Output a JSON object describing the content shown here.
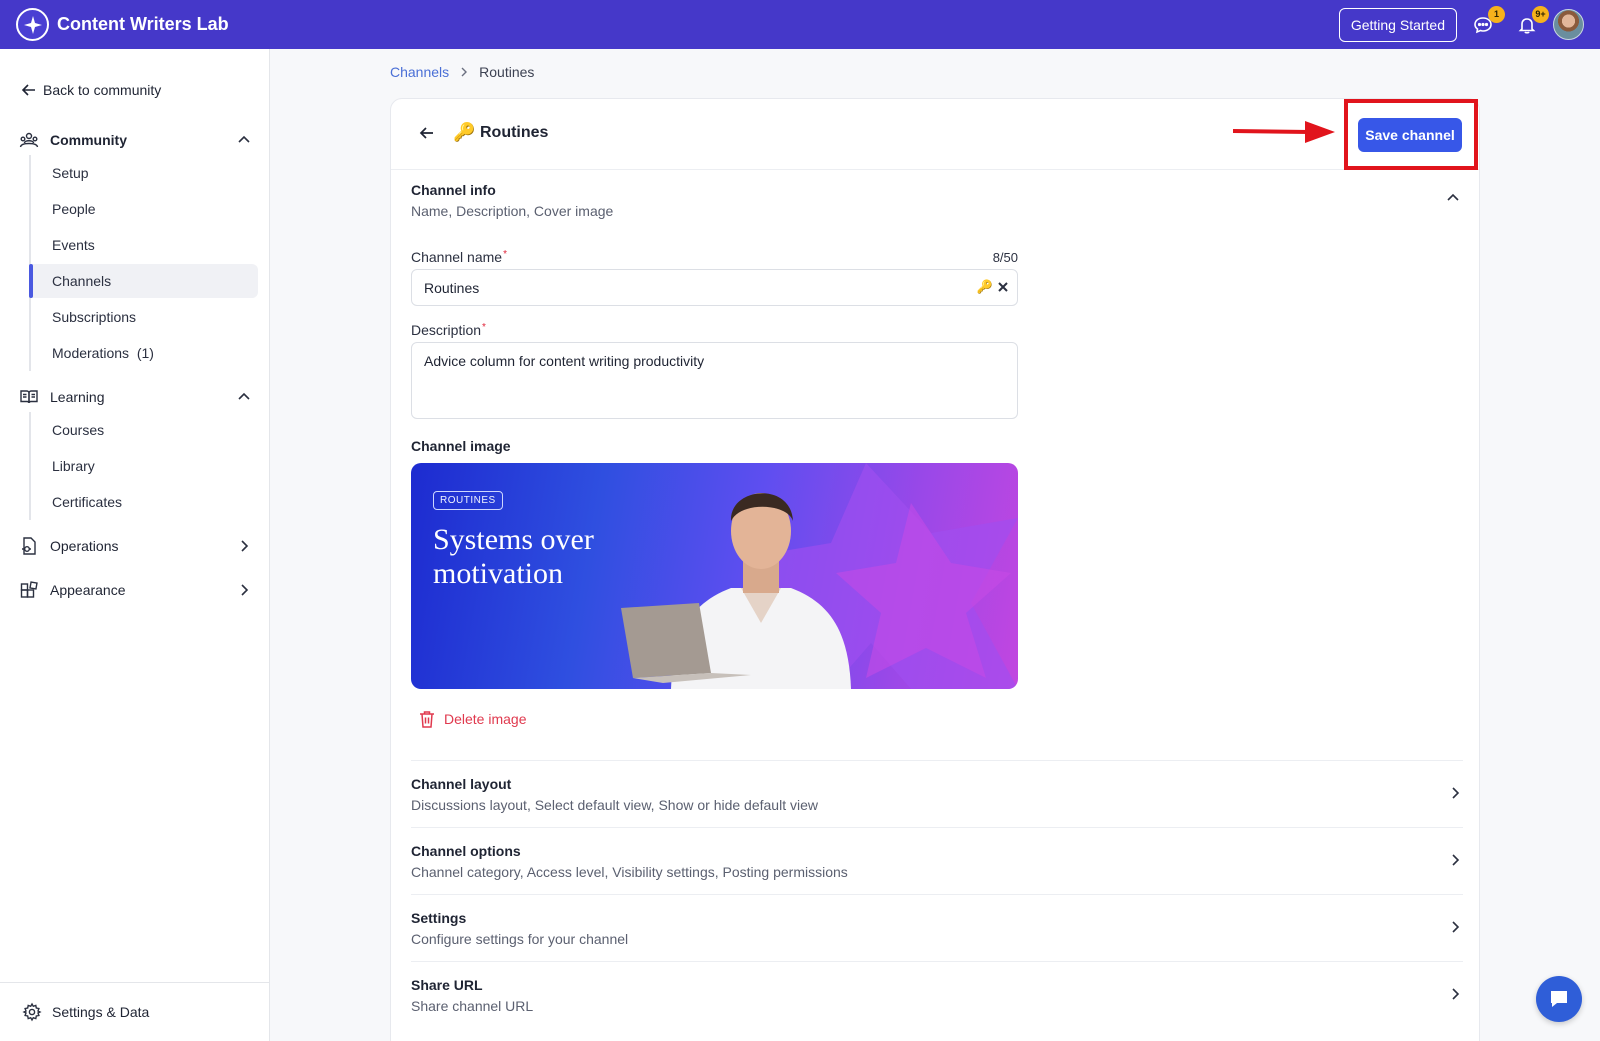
{
  "app": {
    "name": "Content Writers Lab"
  },
  "topbar": {
    "getting_started": "Getting Started",
    "messages_badge": "1",
    "notifications_badge": "9+"
  },
  "sidebar": {
    "back_label": "Back to community",
    "groups": {
      "community": {
        "label": "Community",
        "items": [
          "Setup",
          "People",
          "Events",
          "Channels",
          "Subscriptions",
          "Moderations  (1)"
        ]
      },
      "learning": {
        "label": "Learning",
        "items": [
          "Courses",
          "Library",
          "Certificates"
        ]
      },
      "operations": {
        "label": "Operations"
      },
      "appearance": {
        "label": "Appearance"
      }
    },
    "active_item": "Channels",
    "settings_label": "Settings & Data"
  },
  "breadcrumb": {
    "parent": "Channels",
    "current": "Routines"
  },
  "channel": {
    "emoji": "🔑",
    "title": "Routines",
    "save_label": "Save channel",
    "info_title": "Channel info",
    "info_sub": "Name, Description, Cover image",
    "name_label": "Channel name",
    "name_value": "Routines",
    "name_count": "8/50",
    "desc_label": "Description",
    "desc_value": "Advice column for content writing productivity",
    "image_label": "Channel image",
    "cover_tag": "ROUTINES",
    "cover_headline": "Systems over motivation",
    "delete_label": "Delete image"
  },
  "sections": [
    {
      "title": "Channel layout",
      "sub": "Discussions layout, Select default view, Show or hide default view"
    },
    {
      "title": "Channel options",
      "sub": "Channel category, Access level, Visibility settings, Posting permissions"
    },
    {
      "title": "Settings",
      "sub": "Configure settings for your channel"
    },
    {
      "title": "Share URL",
      "sub": "Share channel URL"
    }
  ],
  "colors": {
    "topbar": "#4538c9",
    "primary": "#3757e8",
    "danger": "#e0394e",
    "annotation": "#e1141c"
  }
}
